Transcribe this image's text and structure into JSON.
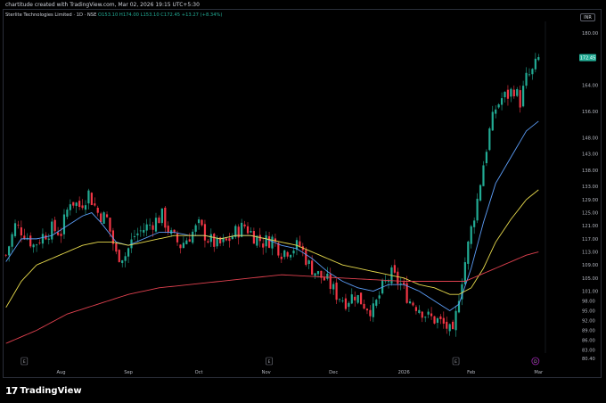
{
  "header": {
    "credit": "chartitude created with TradingView.com, Mar 02, 2026 19:15 UTC+5:30"
  },
  "legend": {
    "symbol": "Sterlite Technologies Limited · 1D · NSE",
    "ohlc": "O153.10 H174.00 L153.10 C172.45 +13.27 (+8.34%)"
  },
  "currency": "INR",
  "footer": {
    "logo": "TradingView"
  },
  "colors": {
    "up": "#22ab94",
    "down": "#f23645",
    "ema_fast": "#5b9cf6",
    "ema_mid": "#e6d94c",
    "ema_slow": "#e0414f",
    "price_badge": "#22ab94"
  },
  "chart_data": {
    "type": "candlestick",
    "ylim": [
      80.4,
      180
    ],
    "y_ticks": [
      180,
      164,
      156,
      148,
      143,
      138,
      133,
      129,
      125,
      121,
      117,
      113,
      109,
      105,
      101,
      98,
      95,
      92,
      89,
      86,
      83,
      80.4
    ],
    "y_tick_labels": [
      "180.00",
      "164.00",
      "156.00",
      "148.00",
      "143.00",
      "138.00",
      "133.00",
      "129.00",
      "125.00",
      "121.00",
      "117.00",
      "113.00",
      "109.00",
      "105.00",
      "101.00",
      "98.00",
      "95.00",
      "92.00",
      "89.00",
      "86.00",
      "83.00",
      "80.40"
    ],
    "x_labels": [
      {
        "label": "Aug",
        "i": 18
      },
      {
        "label": "Sep",
        "i": 40
      },
      {
        "label": "Oct",
        "i": 63
      },
      {
        "label": "Nov",
        "i": 85
      },
      {
        "label": "Dec",
        "i": 107
      },
      {
        "label": "2026",
        "i": 130
      },
      {
        "label": "Feb",
        "i": 152
      },
      {
        "label": "Mar",
        "i": 174
      }
    ],
    "last_price": 172.45,
    "last_price_label": "172.45",
    "event_markers": [
      {
        "label": "E",
        "i": 6
      },
      {
        "label": "E",
        "i": 86
      },
      {
        "label": "E",
        "i": 147
      },
      {
        "label": "D",
        "i": 173,
        "kind": "dividend"
      }
    ],
    "series": [
      {
        "name": "Price",
        "kind": "candles",
        "waypoints": [
          [
            0,
            112
          ],
          [
            3,
            121
          ],
          [
            6,
            119
          ],
          [
            9,
            115
          ],
          [
            12,
            118
          ],
          [
            15,
            120
          ],
          [
            18,
            119
          ],
          [
            21,
            129
          ],
          [
            24,
            127
          ],
          [
            27,
            131
          ],
          [
            30,
            125
          ],
          [
            33,
            123
          ],
          [
            36,
            112
          ],
          [
            39,
            112
          ],
          [
            42,
            118
          ],
          [
            45,
            120
          ],
          [
            48,
            122
          ],
          [
            51,
            124
          ],
          [
            54,
            118
          ],
          [
            57,
            115
          ],
          [
            60,
            118
          ],
          [
            63,
            121
          ],
          [
            66,
            117
          ],
          [
            69,
            115
          ],
          [
            72,
            116
          ],
          [
            75,
            119
          ],
          [
            78,
            121
          ],
          [
            81,
            118
          ],
          [
            84,
            116
          ],
          [
            87,
            117
          ],
          [
            90,
            113
          ],
          [
            93,
            114
          ],
          [
            96,
            115
          ],
          [
            99,
            109
          ],
          [
            102,
            106
          ],
          [
            105,
            104
          ],
          [
            108,
            100
          ],
          [
            111,
            98
          ],
          [
            114,
            100
          ],
          [
            117,
            97
          ],
          [
            120,
            95
          ],
          [
            123,
            102
          ],
          [
            126,
            106
          ],
          [
            129,
            103
          ],
          [
            132,
            98
          ],
          [
            135,
            96
          ],
          [
            138,
            93
          ],
          [
            141,
            92
          ],
          [
            144,
            90
          ],
          [
            146,
            87
          ],
          [
            148,
            100
          ],
          [
            150,
            110
          ],
          [
            152,
            120
          ],
          [
            154,
            129
          ],
          [
            156,
            140
          ],
          [
            158,
            150
          ],
          [
            160,
            157
          ],
          [
            162,
            160
          ],
          [
            164,
            161
          ],
          [
            166,
            163
          ],
          [
            168,
            159
          ],
          [
            170,
            166
          ],
          [
            172,
            168
          ],
          [
            174,
            172
          ]
        ]
      },
      {
        "name": "EMA fast",
        "kind": "line",
        "waypoints": [
          [
            0,
            110
          ],
          [
            5,
            117
          ],
          [
            10,
            117
          ],
          [
            15,
            118
          ],
          [
            20,
            121
          ],
          [
            25,
            124
          ],
          [
            28,
            125
          ],
          [
            31,
            122
          ],
          [
            36,
            116
          ],
          [
            40,
            115
          ],
          [
            45,
            117
          ],
          [
            50,
            119
          ],
          [
            55,
            119
          ],
          [
            60,
            118
          ],
          [
            65,
            118
          ],
          [
            70,
            117
          ],
          [
            75,
            118
          ],
          [
            80,
            118
          ],
          [
            85,
            117
          ],
          [
            90,
            115
          ],
          [
            95,
            114
          ],
          [
            100,
            111
          ],
          [
            105,
            107
          ],
          [
            110,
            104
          ],
          [
            115,
            102
          ],
          [
            120,
            101
          ],
          [
            125,
            103
          ],
          [
            130,
            103
          ],
          [
            135,
            101
          ],
          [
            140,
            98
          ],
          [
            145,
            95
          ],
          [
            148,
            97
          ],
          [
            152,
            108
          ],
          [
            156,
            122
          ],
          [
            160,
            134
          ],
          [
            165,
            142
          ],
          [
            170,
            150
          ],
          [
            174,
            153
          ]
        ]
      },
      {
        "name": "EMA mid",
        "kind": "line",
        "waypoints": [
          [
            0,
            96
          ],
          [
            5,
            104
          ],
          [
            10,
            109
          ],
          [
            15,
            111
          ],
          [
            20,
            113
          ],
          [
            25,
            115
          ],
          [
            30,
            116
          ],
          [
            35,
            116
          ],
          [
            40,
            115
          ],
          [
            45,
            116
          ],
          [
            50,
            117
          ],
          [
            55,
            118
          ],
          [
            60,
            118
          ],
          [
            65,
            118
          ],
          [
            70,
            117
          ],
          [
            75,
            118
          ],
          [
            80,
            118
          ],
          [
            85,
            117
          ],
          [
            90,
            116
          ],
          [
            95,
            115
          ],
          [
            100,
            113
          ],
          [
            105,
            111
          ],
          [
            110,
            109
          ],
          [
            115,
            108
          ],
          [
            120,
            107
          ],
          [
            125,
            106
          ],
          [
            130,
            105
          ],
          [
            135,
            103
          ],
          [
            140,
            102
          ],
          [
            145,
            100
          ],
          [
            148,
            100
          ],
          [
            152,
            102
          ],
          [
            156,
            108
          ],
          [
            160,
            116
          ],
          [
            165,
            123
          ],
          [
            170,
            129
          ],
          [
            174,
            132
          ]
        ]
      },
      {
        "name": "EMA slow",
        "kind": "line",
        "waypoints": [
          [
            0,
            85
          ],
          [
            10,
            89
          ],
          [
            20,
            94
          ],
          [
            30,
            97
          ],
          [
            40,
            100
          ],
          [
            50,
            102
          ],
          [
            60,
            103
          ],
          [
            70,
            104
          ],
          [
            80,
            105
          ],
          [
            90,
            106
          ],
          [
            100,
            105.5
          ],
          [
            110,
            105
          ],
          [
            120,
            104.5
          ],
          [
            130,
            104
          ],
          [
            140,
            104
          ],
          [
            145,
            104
          ],
          [
            150,
            104
          ],
          [
            155,
            106
          ],
          [
            160,
            108
          ],
          [
            165,
            110
          ],
          [
            170,
            112
          ],
          [
            174,
            113
          ]
        ]
      }
    ]
  }
}
